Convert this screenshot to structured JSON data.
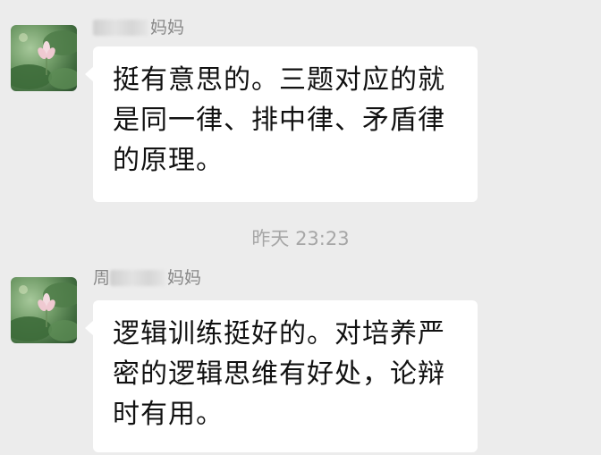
{
  "messages": [
    {
      "sender_prefix": "",
      "sender_suffix": "妈妈",
      "text": "挺有意思的。三题对应的就是同一律、排中律、矛盾律的原理。"
    },
    {
      "sender_prefix": "周",
      "sender_suffix": "妈妈",
      "text": "逻辑训练挺好的。对培养严密的逻辑思维有好处，论辩时有用。"
    }
  ],
  "timestamp": "昨天 23:23",
  "avatar_icon": "lotus-pond-avatar-icon",
  "colors": {
    "background": "#ececec",
    "bubble": "#ffffff",
    "sender_text": "#888888",
    "timestamp_text": "#a6a6a6"
  }
}
